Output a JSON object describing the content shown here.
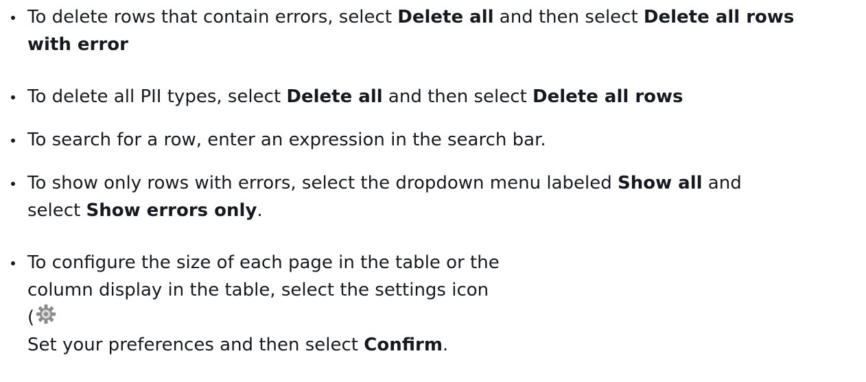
{
  "bullets": [
    {
      "t1": "To delete rows that contain errors, select ",
      "b1": "Delete all",
      "t2": " and then select ",
      "b2": "Delete all rows",
      "b3": "with error"
    },
    {
      "t1": "To delete all PII types, select ",
      "b1": "Delete all",
      "t2": " and then select ",
      "b2": "Delete all rows"
    },
    {
      "t1": "To search for a row, enter an expression in the search bar."
    },
    {
      "t1": "To show only rows with errors, select the dropdown menu labeled ",
      "b1": "Show all",
      "t2": " and",
      "t3": "select ",
      "b2": "Show errors only",
      "t4": "."
    },
    {
      "l1": "To configure the size of each page in the table or the",
      "l2": "column display in the table, select the settings icon",
      "paren": "(",
      "icon": "settings-gear-icon",
      "t1": "Set your preferences and then select ",
      "b1": "Confirm",
      "t2": "."
    }
  ]
}
